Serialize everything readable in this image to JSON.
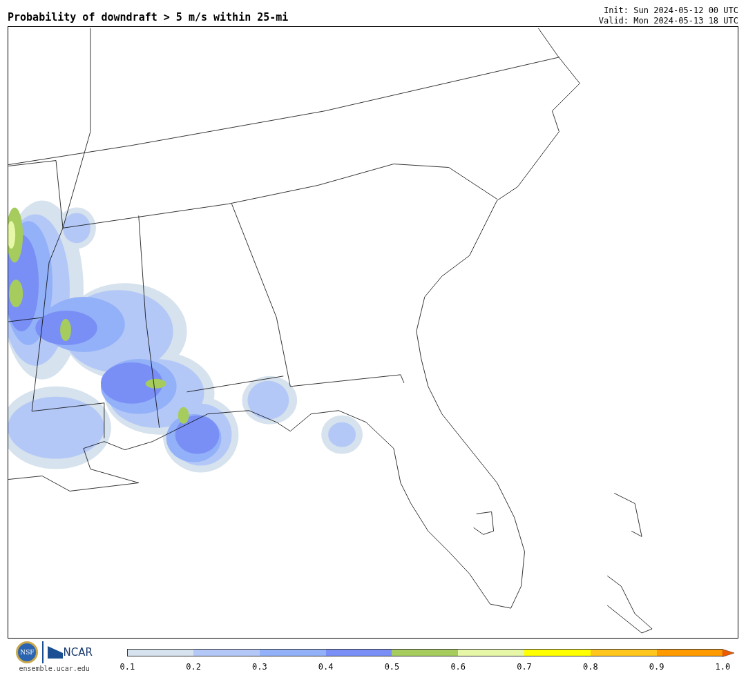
{
  "title": "Probability of downdraft > 5 m/s within 25-mi",
  "init": "Init: Sun 2024-05-12 00 UTC",
  "valid": "Valid: Mon 2024-05-13 18 UTC",
  "logos": {
    "seal": "NSF",
    "org": "NCAR",
    "site": "ensemble.ucar.edu"
  },
  "colorbar": {
    "segments": [
      {
        "color": "#d6e2ed"
      },
      {
        "color": "#b4c8f7"
      },
      {
        "color": "#93b1f8"
      },
      {
        "color": "#7a8ff5"
      },
      {
        "color": "#a6cc5e"
      },
      {
        "color": "#e6f7a8"
      },
      {
        "color": "#ffff00"
      },
      {
        "color": "#ffc61e"
      },
      {
        "color": "#ff9a00"
      }
    ],
    "extend_arrow": {
      "color": "#f05a00"
    },
    "ticks": [
      "0.1",
      "0.2",
      "0.3",
      "0.4",
      "0.5",
      "0.6",
      "0.7",
      "0.8",
      "0.9",
      "1.0"
    ]
  }
}
